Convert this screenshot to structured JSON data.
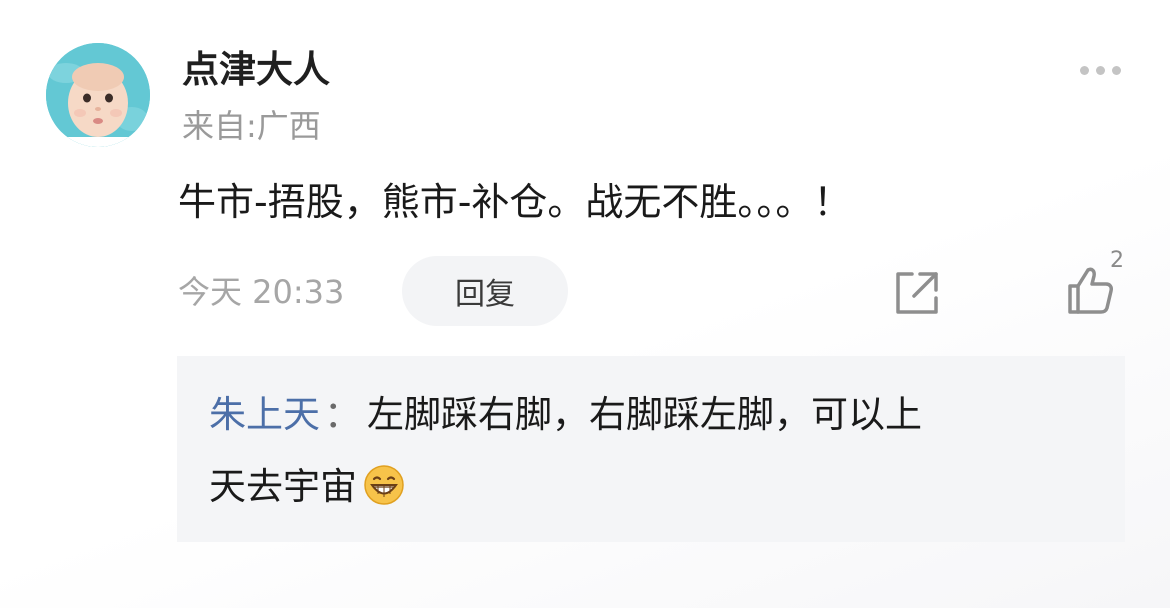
{
  "comment": {
    "username": "点津大人",
    "location": "来自:广西",
    "text": "牛市-捂股，熊市-补仓。战无不胜。。。！",
    "timestamp": "今天 20:33",
    "reply_label": "回复",
    "like_count": "2"
  },
  "icons": {
    "more": "more-dots-icon",
    "share": "share-icon",
    "like": "thumbs-up-icon",
    "emoji": "grinning-emoji-icon"
  },
  "reply": {
    "author": "朱上天",
    "separator": "：",
    "text_line1": "左脚踩右脚，右脚踩左脚，可以上",
    "text_line2": "天去宇宙"
  },
  "colors": {
    "author_link": "#4c6fa8",
    "reply_bg": "#f4f5f7",
    "muted_text": "#9a9a9a"
  }
}
